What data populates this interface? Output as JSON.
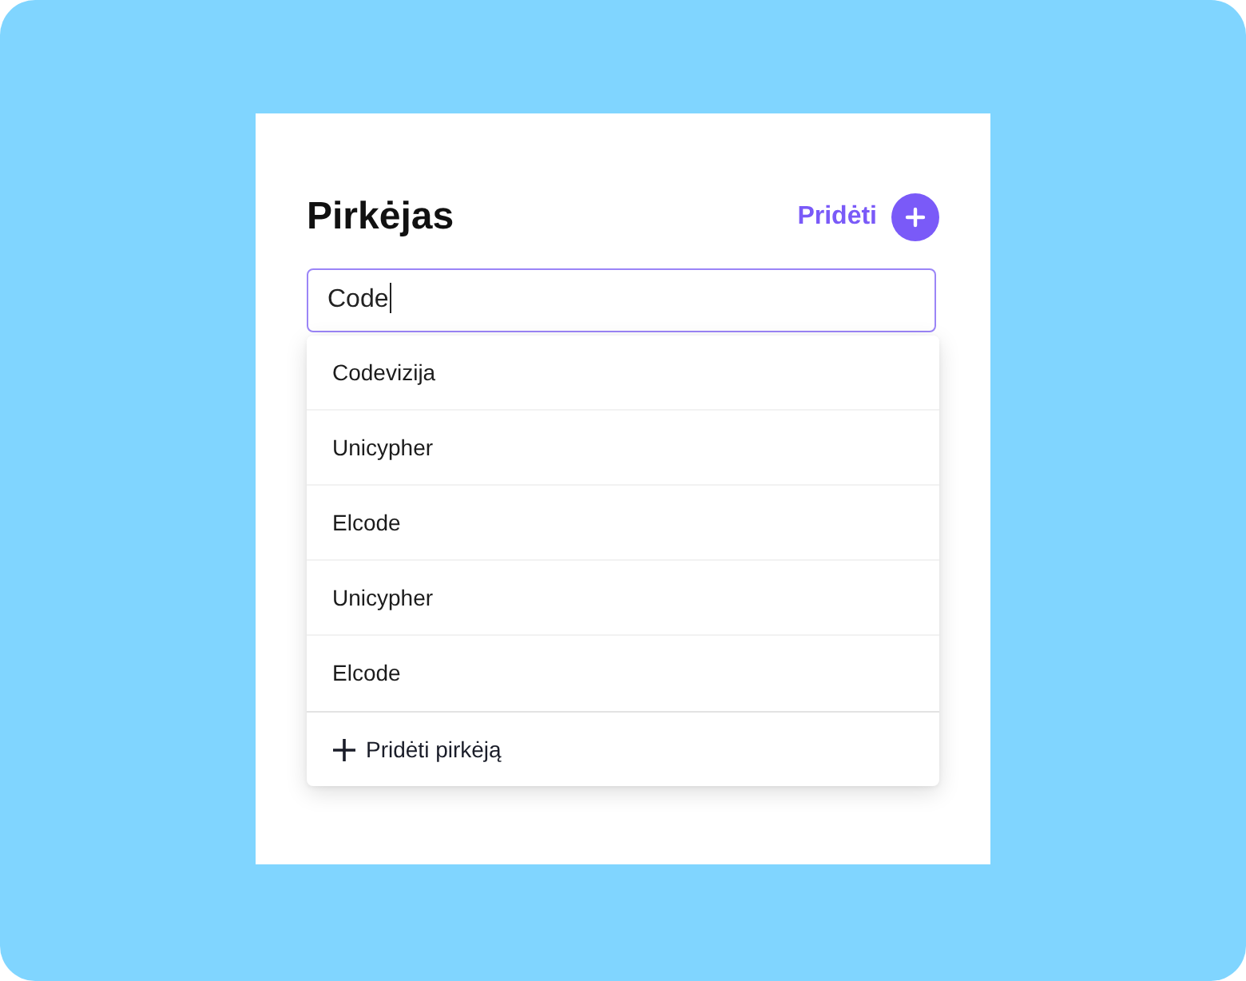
{
  "header": {
    "title": "Pirkėjas",
    "add_button": {
      "label": "Pridėti"
    }
  },
  "search": {
    "value": "Code",
    "focused": true
  },
  "suggestions": [
    {
      "label": "Codevizija"
    },
    {
      "label": "Unicypher"
    },
    {
      "label": "Elcode"
    },
    {
      "label": "Unicypher"
    },
    {
      "label": "Elcode"
    }
  ],
  "footer_action": {
    "label": "Pridėti pirkėją"
  }
}
